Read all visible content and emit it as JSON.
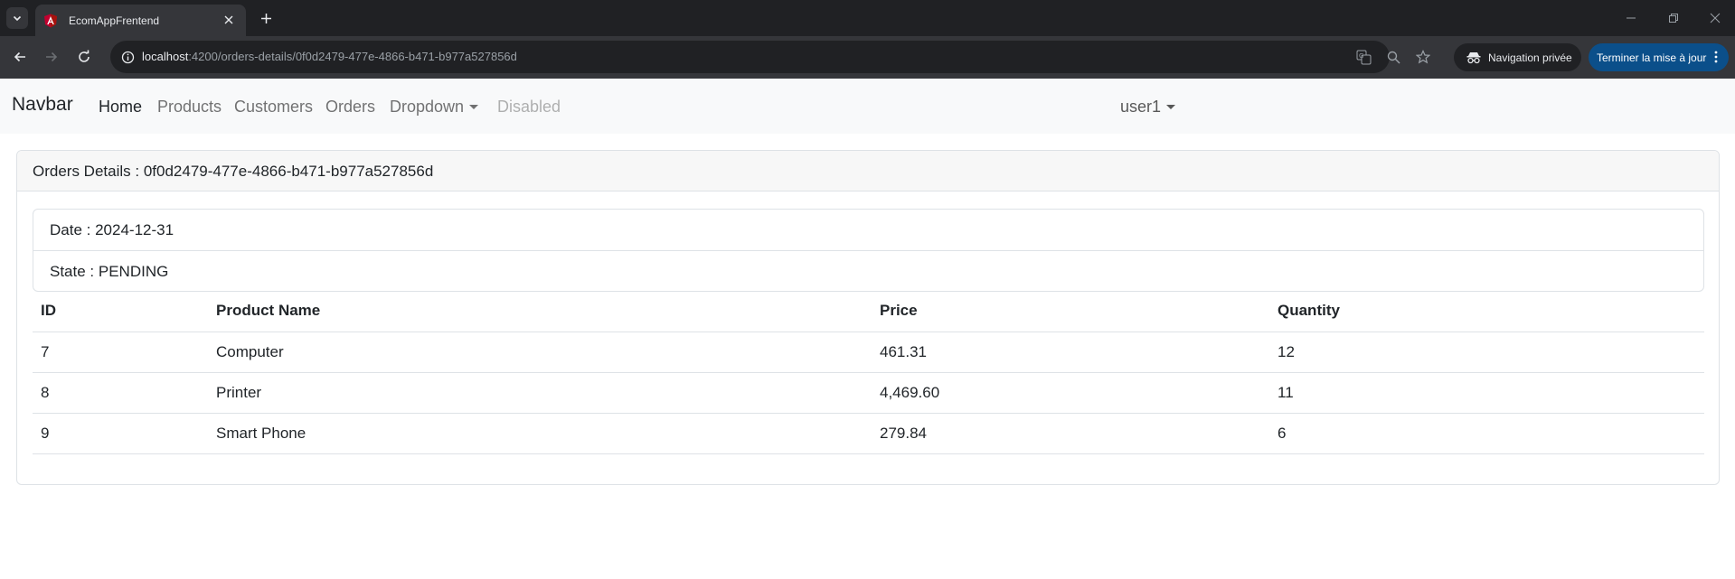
{
  "browser": {
    "tab_title": "EcomAppFrentend",
    "url_host": "localhost",
    "url_path": ":4200/orders-details/0f0d2479-477e-4866-b471-b977a527856d",
    "private_label": "Navigation privée",
    "update_label": "Terminer la mise à jour",
    "colors": {
      "chrome_dark": "#202124",
      "chrome_mid": "#35363a",
      "update_blue": "#0b4f8a"
    }
  },
  "navbar": {
    "brand": "Navbar",
    "links": [
      {
        "label": "Home",
        "state": "active"
      },
      {
        "label": "Products",
        "state": "normal"
      },
      {
        "label": "Customers",
        "state": "normal"
      },
      {
        "label": "Orders",
        "state": "normal"
      },
      {
        "label": "Dropdown",
        "state": "normal"
      },
      {
        "label": "Disabled",
        "state": "disabled"
      }
    ],
    "user": "user1"
  },
  "order": {
    "header_prefix": "Orders Details :",
    "id": "0f0d2479-477e-4866-b471-b977a527856d",
    "date_label": "Date :",
    "date": "2024-12-31",
    "state_label": "State :",
    "state": "PENDING"
  },
  "table": {
    "columns": [
      "ID",
      "Product Name",
      "Price",
      "Quantity"
    ],
    "rows": [
      [
        "7",
        "Computer",
        "461.31",
        "12"
      ],
      [
        "8",
        "Printer",
        "4,469.60",
        "11"
      ],
      [
        "9",
        "Smart Phone",
        "279.84",
        "6"
      ]
    ]
  }
}
